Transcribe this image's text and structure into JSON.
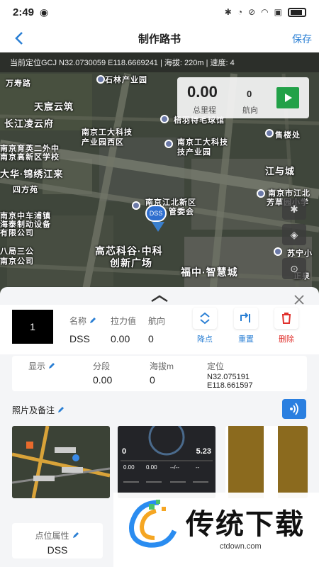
{
  "status_bar": {
    "time": "2:49"
  },
  "header": {
    "title": "制作路书",
    "save_label": "保存"
  },
  "map": {
    "location_text": "当前定位GCJ N32.0730059 E118.6669241 | 海拔: 220m | 速度: 4",
    "stats": {
      "distance_value": "0.00",
      "distance_label": "总里程",
      "heading_value": "0",
      "heading_label": "航向"
    },
    "marker_label": "DSS",
    "labels": [
      "石林产业园",
      "天宸云筑",
      "长江凌云府",
      "南京工大科技",
      "产业园西区",
      "南京工大科技",
      "技产业园",
      "南京育英二外中",
      "南京高新区学校",
      "大华·锦绣江来",
      "四方苑",
      "南京中车浦镇",
      "海泰制动设备",
      "有限公司",
      "八局三公",
      "南京公司",
      "高芯科谷·中科",
      "创新广场",
      "南京江北新区",
      "管委会",
      "福中·智慧城",
      "江与城",
      "南京市江北",
      "芳草园小学",
      "苏宁小",
      "正泉",
      "售楼处",
      "梧羽特毛球馆",
      "万寿路"
    ]
  },
  "point_card": {
    "number": "1",
    "name_label": "名称",
    "name_value": "DSS",
    "pull_label": "拉力值",
    "pull_value": "0.00",
    "heading_label": "航向",
    "heading_value": "0",
    "actions": {
      "down": "降点",
      "reset": "重置",
      "delete": "删除"
    }
  },
  "info_card": {
    "display_label": "显示",
    "segment_label": "分段",
    "segment_value": "0.00",
    "altitude_label": "海拔m",
    "altitude_value": "0",
    "position_label": "定位",
    "lat": "N32.075191",
    "lng": "E118.661597"
  },
  "photos": {
    "title": "照片及备注",
    "dash_left": "0",
    "dash_right": "5.23",
    "dash_vals": [
      "0.00",
      "0.00",
      "--/--",
      "--"
    ]
  },
  "attribute_card": {
    "label": "点位属性",
    "value": "DSS"
  },
  "watermark": {
    "text": "传统下载",
    "url": "ctdown.com"
  },
  "colors": {
    "accent": "#2a7fd4",
    "play": "#22a148",
    "delete": "#e0302c"
  }
}
